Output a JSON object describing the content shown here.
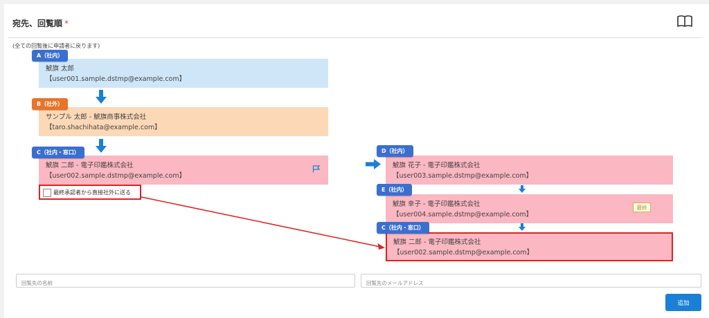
{
  "header": {
    "title": "宛先、回覧順",
    "required_mark": "*",
    "icon": "book-open-icon"
  },
  "note": "(全ての回覧後に申請者に戻ります)",
  "left_route": [
    {
      "tag": "A（社内）",
      "line1": "鯱旗 太郎",
      "line2": "【user001.sample.dstmp@example.com】"
    },
    {
      "tag": "B（社外）",
      "line1": "サンプル 太郎 - 鯱旗商事株式会社",
      "line2": "【taro.shachihata@example.com】"
    },
    {
      "tag": "C（社内・窓口）",
      "line1": "鯱旗 二郎 - 電子印鑑株式会社",
      "line2": "【user002.sample.dstmp@example.com】"
    }
  ],
  "checkbox": {
    "label": "最終承認者から直接社外に送る",
    "checked": false
  },
  "right_route": [
    {
      "tag": "D（社内）",
      "line1": "鯱旗 花子 - 電子印鑑株式会社",
      "line2": "【user003.sample.dstmp@example.com】"
    },
    {
      "tag": "E（社内）",
      "line1": "鯱旗 幸子 - 電子印鑑株式会社",
      "line2": "【user004.sample.dstmp@example.com】",
      "badge": "最終"
    },
    {
      "tag": "C（社内・窓口）",
      "line1": "鯱旗 二郎 - 電子印鑑株式会社",
      "line2": "【user002.sample.dstmp@example.com】"
    }
  ],
  "form": {
    "name_placeholder": "回覧先の名前",
    "email_placeholder": "回覧先のメールアドレス",
    "add_label": "追加"
  },
  "colors": {
    "tag_blue": "#3a6fd0",
    "tag_orange": "#e8732a",
    "box_light_blue": "#cfe6f8",
    "box_light_orange": "#fcd8b6",
    "box_pink": "#fbb7c2",
    "highlight_red": "#e02020",
    "arrow_blue": "#1b7fd6",
    "button_blue": "#1b7fd6"
  }
}
